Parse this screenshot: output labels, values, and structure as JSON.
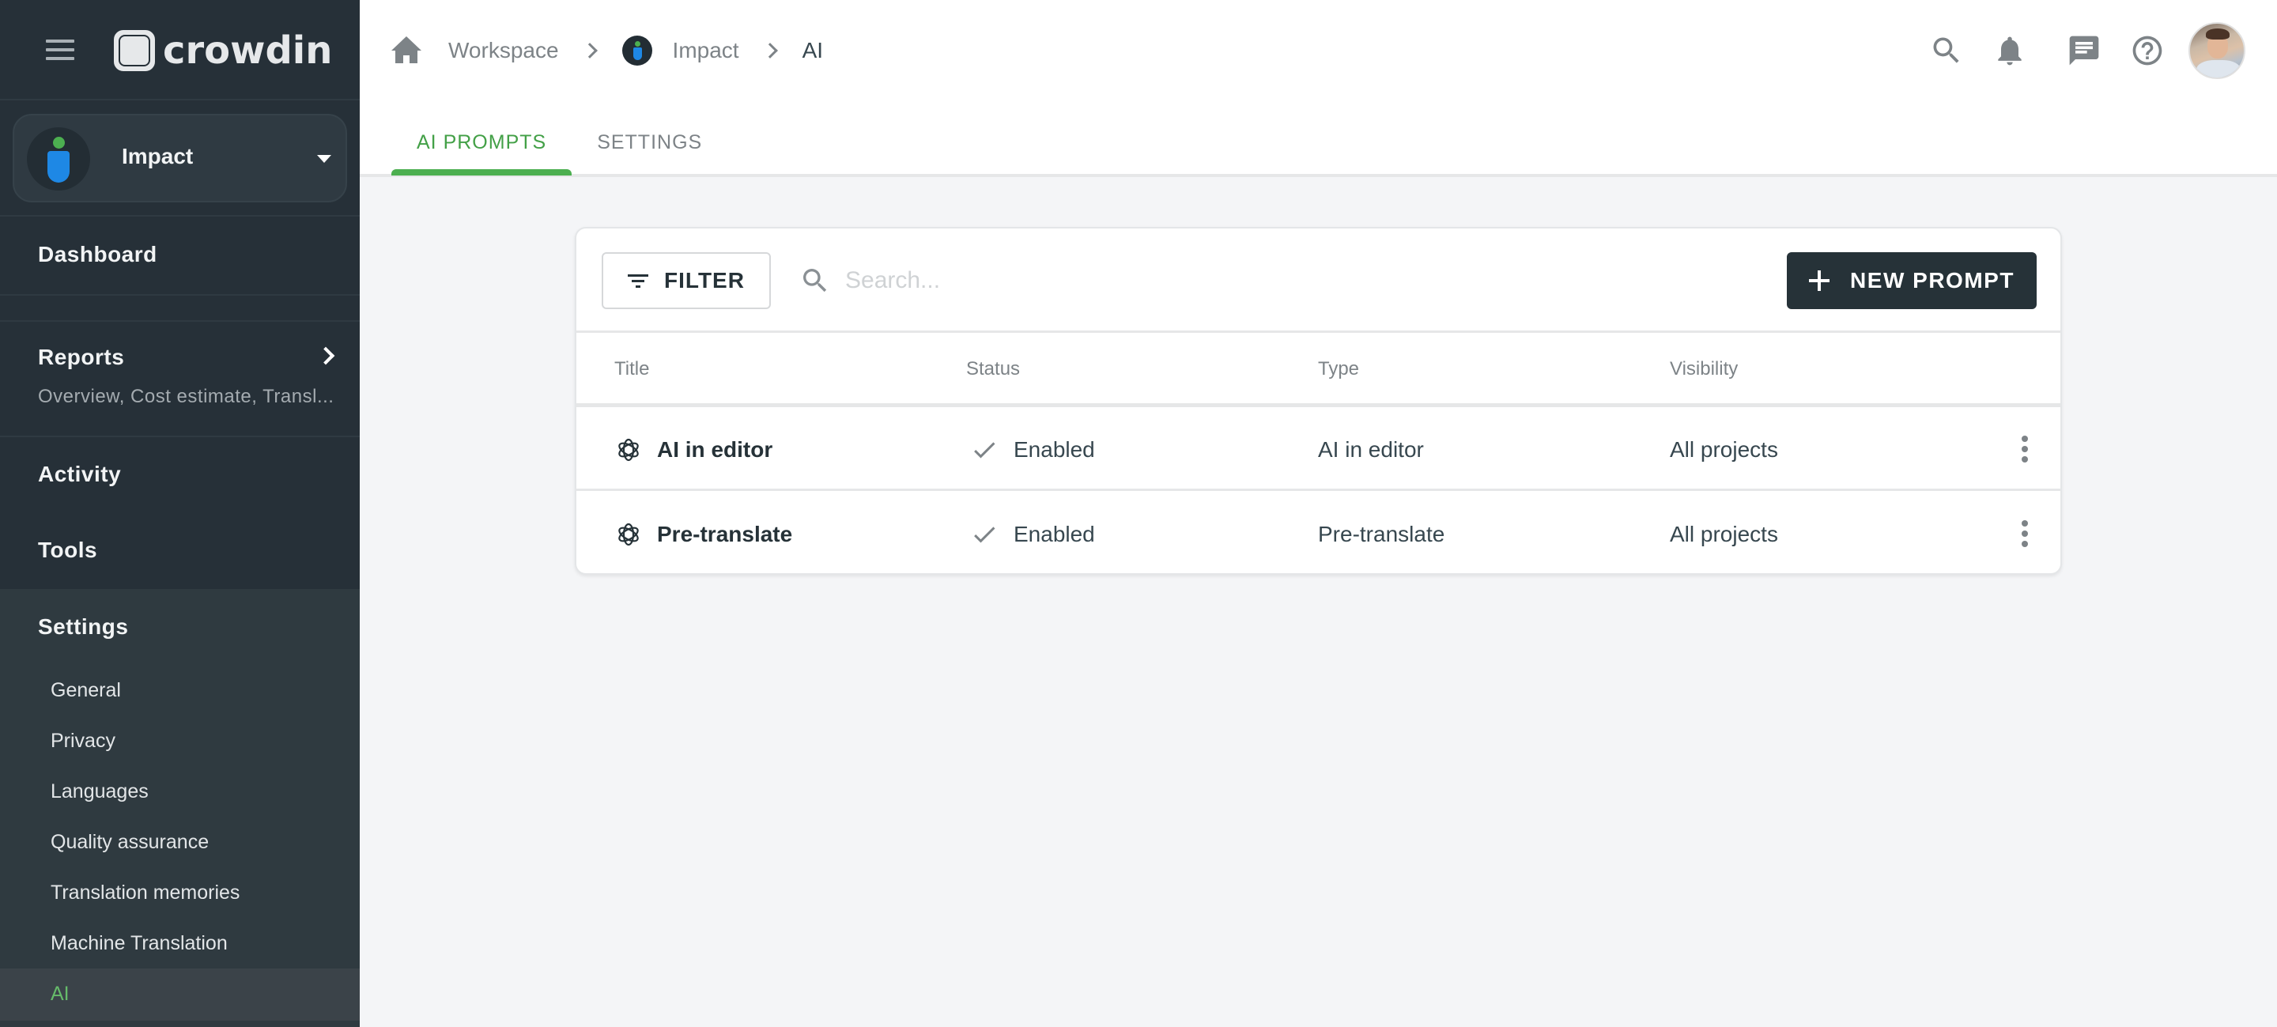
{
  "app": {
    "logo_text": "crowdin"
  },
  "sidebar": {
    "project": {
      "name": "Impact"
    },
    "nav": {
      "dashboard": "Dashboard",
      "reports": {
        "label": "Reports",
        "subtitle": "Overview, Cost estimate, Transl..."
      },
      "activity": "Activity",
      "tools": "Tools",
      "settings": {
        "label": "Settings",
        "items": [
          {
            "label": "General"
          },
          {
            "label": "Privacy"
          },
          {
            "label": "Languages"
          },
          {
            "label": "Quality assurance"
          },
          {
            "label": "Translation memories"
          },
          {
            "label": "Machine Translation"
          },
          {
            "label": "AI",
            "active": true
          }
        ]
      }
    }
  },
  "header": {
    "breadcrumb": [
      {
        "label": "Workspace",
        "icon": "home-icon"
      },
      {
        "label": "Impact",
        "icon": "project-icon"
      },
      {
        "label": "AI"
      }
    ],
    "icons": [
      "search-icon",
      "bell-icon",
      "chat-icon",
      "help-icon",
      "avatar"
    ],
    "tabs": [
      {
        "label": "AI PROMPTS",
        "active": true
      },
      {
        "label": "SETTINGS",
        "active": false
      }
    ]
  },
  "toolbar": {
    "filter_label": "FILTER",
    "search_placeholder": "Search...",
    "search_value": "",
    "new_prompt_label": "NEW PROMPT"
  },
  "table": {
    "columns": [
      "Title",
      "Status",
      "Type",
      "Visibility"
    ],
    "rows": [
      {
        "title": "AI in editor",
        "status": "Enabled",
        "type": "AI in editor",
        "visibility": "All projects"
      },
      {
        "title": "Pre-translate",
        "status": "Enabled",
        "type": "Pre-translate",
        "visibility": "All projects"
      }
    ]
  },
  "colors": {
    "sidebar_bg": "#263038",
    "accent_green": "#4caf50",
    "primary_button": "#263238"
  }
}
